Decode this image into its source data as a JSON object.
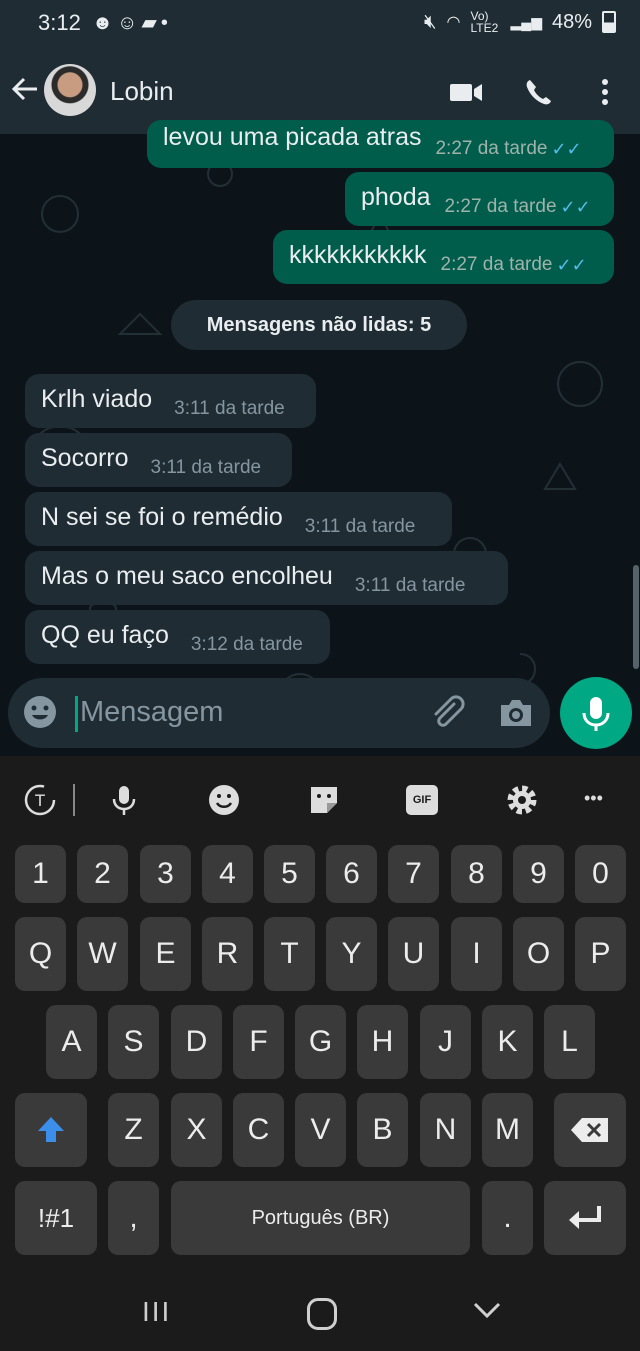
{
  "status_bar": {
    "time": "3:12",
    "battery": "48%",
    "network": "Vo) LTE2"
  },
  "header": {
    "contact_name": "Lobin"
  },
  "messages_out": [
    {
      "text": "levou uma picada atras",
      "time": "2:27 da tarde"
    },
    {
      "text": "phoda",
      "time": "2:27 da tarde"
    },
    {
      "text": "kkkkkkkkkkk",
      "time": "2:27 da tarde"
    }
  ],
  "unread_label": "Mensagens não lidas: 5",
  "messages_in": [
    {
      "text": "Krlh viado",
      "time": "3:11 da tarde"
    },
    {
      "text": "Socorro",
      "time": "3:11 da tarde"
    },
    {
      "text": "N sei se foi o remédio",
      "time": "3:11 da tarde"
    },
    {
      "text": "Mas o meu saco encolheu",
      "time": "3:11 da tarde"
    },
    {
      "text": "QQ eu faço",
      "time": "3:12 da tarde"
    }
  ],
  "composer": {
    "placeholder": "Mensagem"
  },
  "keyboard": {
    "toolbar": [
      "translate-icon",
      "mic-icon",
      "emoji-icon",
      "sticker-icon",
      "gif-icon",
      "settings-icon",
      "more-icon"
    ],
    "gif_label": "GIF",
    "more_label": "•••",
    "row_numbers": [
      "1",
      "2",
      "3",
      "4",
      "5",
      "6",
      "7",
      "8",
      "9",
      "0"
    ],
    "row1": [
      "Q",
      "W",
      "E",
      "R",
      "T",
      "Y",
      "U",
      "I",
      "O",
      "P"
    ],
    "row2": [
      "A",
      "S",
      "D",
      "F",
      "G",
      "H",
      "J",
      "K",
      "L"
    ],
    "row3": [
      "Z",
      "X",
      "C",
      "V",
      "B",
      "N",
      "M"
    ],
    "symbols_label": "!#1",
    "comma_label": ",",
    "space_label": "Português (BR)",
    "period_label": ".",
    "nav": {
      "recents": "III"
    }
  },
  "colors": {
    "accent": "#00a884",
    "outgoing": "#005c4b",
    "incoming": "#1f2c34",
    "read_tick": "#53bdeb"
  }
}
